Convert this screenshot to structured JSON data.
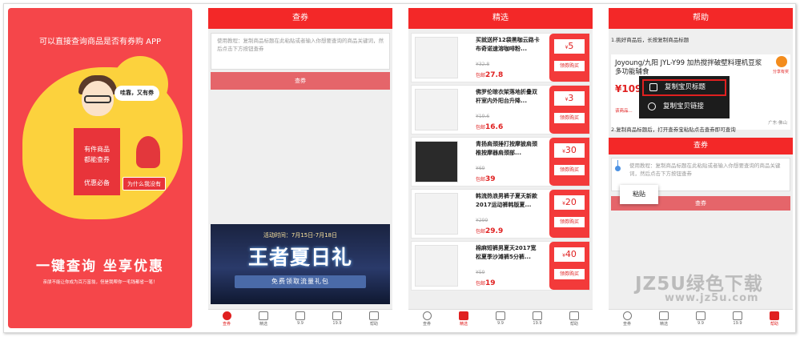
{
  "splash": {
    "title": "可以直接查询商品是否有券购 APP",
    "speech": "哇靠，又有券",
    "box_text": "有件商品\n都能查券",
    "box_sub": "优惠必备",
    "why_button": "为什么我没有",
    "slogan": "一键查询 坐享优惠",
    "slogan_sub": "亲朋不能让你成为百万富翁，但是我帮你一毛钱都省一笔！"
  },
  "coupon_screen": {
    "title": "查券",
    "tutorial_placeholder": "使用教程：复制商品标题在此粘贴或者输入你想要查询的商品关键词，然后点击下方按钮查券",
    "query_button": "查券",
    "banner": {
      "date": "活动时间：7月15日-7月18日",
      "title": "王者夏日礼",
      "subtitle": "免费领取流量礼包"
    }
  },
  "picks_screen": {
    "title": "精选",
    "products": [
      {
        "name": "买就送杯12袋黑咖云路卡布奇诺速溶咖啡粉...",
        "orig": "¥32.8",
        "after_label": "包邮",
        "after": "27.8",
        "coupon": "5",
        "coupon_btn": "领券购买",
        "thumb": "coffee"
      },
      {
        "name": "佛罗伦晾衣架落地折叠双杆室内外阳台升降...",
        "orig": "¥19.6",
        "after_label": "包邮",
        "after": "16.6",
        "coupon": "3",
        "coupon_btn": "领券购买",
        "thumb": "rack"
      },
      {
        "name": "青扬肩颈捶打按摩披肩颈椎按摩器肩颈部...",
        "orig": "¥69",
        "after_label": "包邮",
        "after": "39",
        "coupon": "30",
        "coupon_btn": "领券购买",
        "thumb": "massager"
      },
      {
        "name": "韩流热浪男裤子夏天新款2017运动裤韩版夏...",
        "orig": "¥299",
        "after_label": "包邮",
        "after": "29.9",
        "coupon": "20",
        "coupon_btn": "领券购买",
        "thumb": "pants"
      },
      {
        "name": "棉麻短裤男夏天2017宽松夏季沙滩裤5分裤...",
        "orig": "¥59",
        "after_label": "包邮",
        "after": "19",
        "coupon": "40",
        "coupon_btn": "领券购买",
        "thumb": "shorts"
      }
    ]
  },
  "help_screen": {
    "title": "帮助",
    "step1": "1.挑好商品后，长按复制商品标题",
    "product_name": "Joyoung/九阳 JYL-Y99 加热搅拌破壁料理机豆浆多功能辅食",
    "price": "¥1099",
    "share": "分享有奖",
    "location": "广东·佛山",
    "discount_row": "该商品...",
    "popup": {
      "copy_title": "复制宝贝标题",
      "copy_link": "复制宝贝链接"
    },
    "step2": "2.复制商品标题后，打开查券宝粘贴点击查券即可查询",
    "query_title": "查券",
    "tutorial_placeholder": "使用教程：复制商品标题在此粘贴或者输入你想要查询的商品关键词，然后点击下方按钮查券",
    "paste": "粘贴",
    "query_button": "查券"
  },
  "tabs": [
    "查券",
    "精选",
    "9.9",
    "19.9",
    "帮助"
  ],
  "watermark": {
    "line1": "JZ5U绿色下载",
    "line2": "www.jz5u.com"
  },
  "colors": {
    "brand_red": "#f32828",
    "splash_red": "#f5464a",
    "yellow": "#fcd23d"
  }
}
